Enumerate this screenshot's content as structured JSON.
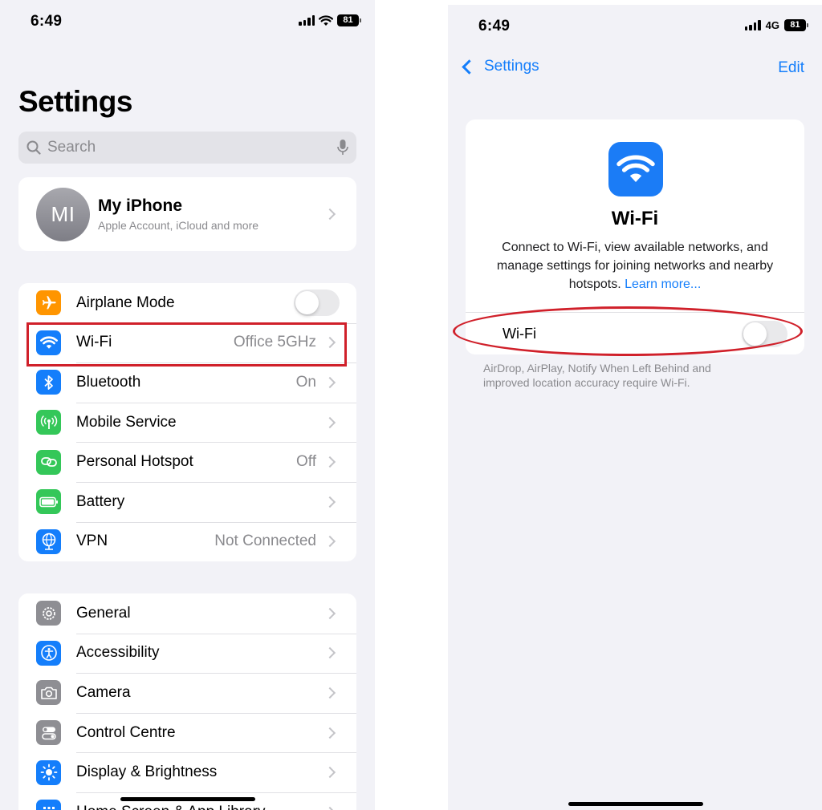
{
  "left": {
    "status": {
      "time": "6:49",
      "battery": "81"
    },
    "title": "Settings",
    "search": {
      "placeholder": "Search"
    },
    "profile": {
      "initials": "MI",
      "name": "My iPhone",
      "subtitle": "Apple Account, iCloud and more"
    },
    "group1": [
      {
        "label": "Airplane Mode",
        "value": "",
        "icon": "airplane-icon",
        "color": "#ff9500",
        "toggle": true
      },
      {
        "label": "Wi-Fi",
        "value": "Office 5GHz",
        "icon": "wifi-icon",
        "color": "#147efb"
      },
      {
        "label": "Bluetooth",
        "value": "On",
        "icon": "bluetooth-icon",
        "color": "#147efb"
      },
      {
        "label": "Mobile Service",
        "value": "",
        "icon": "antenna-icon",
        "color": "#34c759"
      },
      {
        "label": "Personal Hotspot",
        "value": "Off",
        "icon": "hotspot-icon",
        "color": "#34c759"
      },
      {
        "label": "Battery",
        "value": "",
        "icon": "battery-icon",
        "color": "#34c759"
      },
      {
        "label": "VPN",
        "value": "Not Connected",
        "icon": "globe-icon",
        "color": "#147efb"
      }
    ],
    "group2": [
      {
        "label": "General",
        "icon": "gear-icon",
        "color": "#8e8e93"
      },
      {
        "label": "Accessibility",
        "icon": "accessibility-icon",
        "color": "#147efb"
      },
      {
        "label": "Camera",
        "icon": "camera-icon",
        "color": "#8e8e93"
      },
      {
        "label": "Control Centre",
        "icon": "switches-icon",
        "color": "#8e8e93"
      },
      {
        "label": "Display & Brightness",
        "icon": "sun-icon",
        "color": "#147efb"
      },
      {
        "label": "Home Screen & App Library",
        "icon": "grid-icon",
        "color": "#147efb"
      }
    ]
  },
  "right": {
    "status": {
      "time": "6:49",
      "network": "4G",
      "battery": "81"
    },
    "nav": {
      "back": "Settings",
      "edit": "Edit"
    },
    "wifi": {
      "title": "Wi-Fi",
      "description": "Connect to Wi-Fi, view available networks, and manage settings for joining networks and nearby hotspots.",
      "link": "Learn more...",
      "toggle_label": "Wi-Fi",
      "toggle_on": false,
      "footnote": "AirDrop, AirPlay, Notify When Left Behind and improved location accuracy require Wi-Fi."
    }
  },
  "colors": {
    "accent": "#147efb",
    "highlight": "#d0202a"
  }
}
